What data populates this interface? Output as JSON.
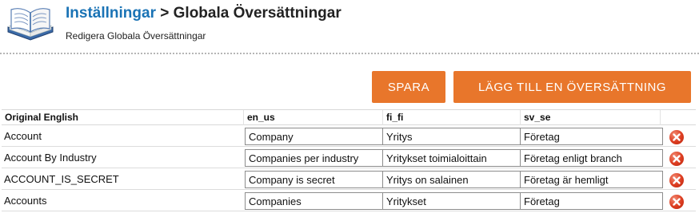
{
  "header": {
    "breadcrumb_parent": "Inställningar",
    "breadcrumb_separator": ">",
    "breadcrumb_current": "Globala Översättningar",
    "subtitle": "Redigera Globala Översättningar",
    "icon": "book-icon"
  },
  "toolbar": {
    "save_label": "SPARA",
    "add_label": "LÄGG TILL EN ÖVERSÄTTNING",
    "accent_color": "#e8762b"
  },
  "table": {
    "columns": [
      "Original English",
      "en_us",
      "fi_fi",
      "sv_se"
    ],
    "rows": [
      {
        "key": "Account",
        "en_us": "Company",
        "fi_fi": "Yritys",
        "sv_se": "Företag"
      },
      {
        "key": "Account By Industry",
        "en_us": "Companies per industry",
        "fi_fi": "Yritykset toimialoittain",
        "sv_se": "Företag enligt branch"
      },
      {
        "key": "ACCOUNT_IS_SECRET",
        "en_us": "Company is secret",
        "fi_fi": "Yritys on salainen",
        "sv_se": "Företag är hemligt"
      },
      {
        "key": "Accounts",
        "en_us": "Companies",
        "fi_fi": "Yritykset",
        "sv_se": "Företag"
      }
    ],
    "delete_icon": "delete-x-icon",
    "delete_color": "#dc3b1f"
  }
}
